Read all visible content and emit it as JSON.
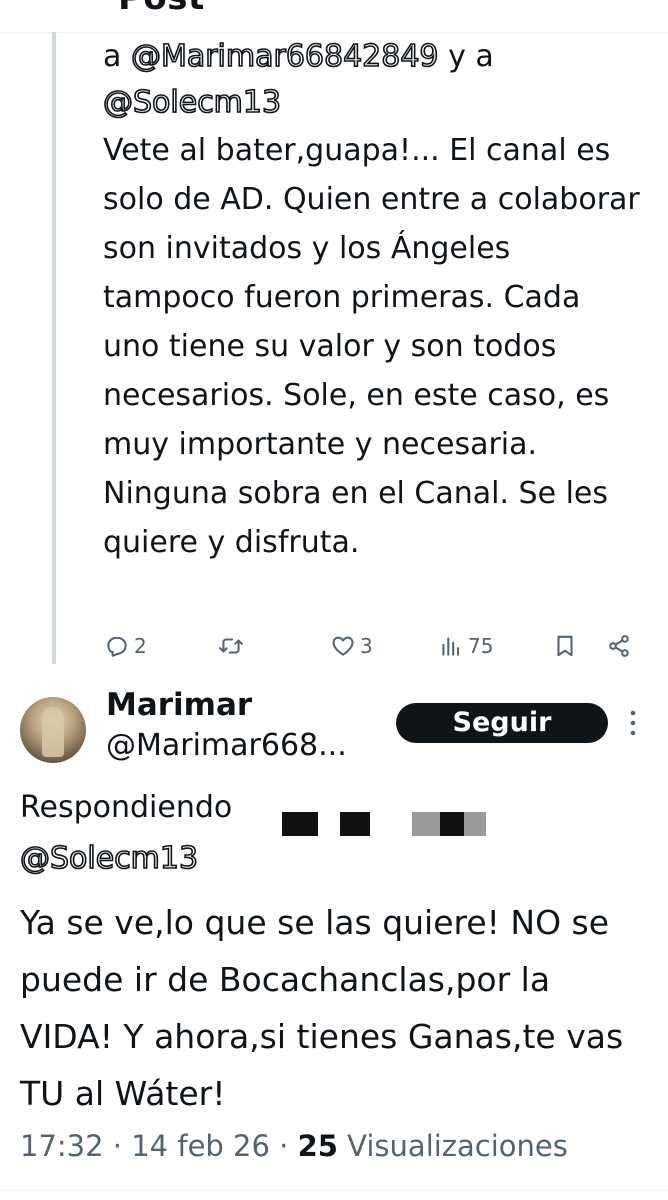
{
  "header": {
    "title": "Post"
  },
  "previous_post": {
    "reply_prefix": "a",
    "reply_mention_1": "@Marimar66842849",
    "reply_joiner": "y a",
    "reply_mention_2": "@Solecm13",
    "body": "Vete al bater,guapa!... El canal es solo de AD. Quien entre a colaborar son invitados y los Ángeles tampoco fueron primeras. Cada uno tiene su valor y son todos necesarios. Sole, en este caso, es muy importante y necesaria. Ninguna sobra en el Canal. Se les quiere y disfruta.",
    "actions": {
      "replies": "2",
      "reposts": "",
      "likes": "3",
      "views": "75",
      "icons": [
        "reply-icon",
        "repost-icon",
        "like-icon",
        "views-icon",
        "bookmark-icon",
        "share-icon"
      ]
    }
  },
  "main_post": {
    "author_name": "Marimar",
    "author_handle": "@Marimar668...",
    "follow_label": "Seguir",
    "replying_to_label": "Respondiendo",
    "replying_to_mention": "@Solecm13",
    "body": "Ya se ve,lo que se las quiere! NO se puede ir de Bocachanclas,por la VIDA! Y ahora,si tienes Ganas,te vas TU al Wáter!",
    "time": "17:32",
    "separator": "·",
    "date": "14 feb 26",
    "views_count": "25",
    "views_label": "Visualizaciones"
  },
  "colors": {
    "text": "#0f1419",
    "secondary": "#536471",
    "thread_line": "#cfd9de",
    "button_bg": "#0f1419",
    "button_text": "#ffffff"
  }
}
